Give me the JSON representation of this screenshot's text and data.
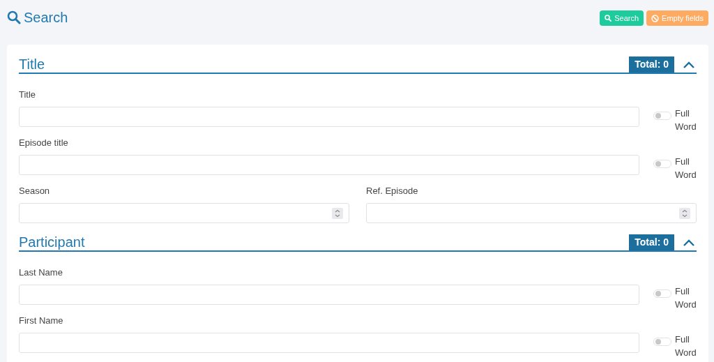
{
  "page": {
    "title": "Search"
  },
  "actions": [
    {
      "kind": "search",
      "label": "Search"
    },
    {
      "kind": "clear",
      "label": "Empty fields"
    }
  ],
  "sections": [
    {
      "title": "Title",
      "total": "Total: 0",
      "expanded": true,
      "rows": [
        {
          "fields": [
            {
              "kind": "text",
              "label": "Title",
              "toggle": {
                "label": "Full Word",
                "on": false
              }
            }
          ]
        },
        {
          "fields": [
            {
              "kind": "text",
              "label": "Episode title",
              "toggle": {
                "label": "Full Word",
                "on": false
              }
            }
          ]
        },
        {
          "fields": [
            {
              "kind": "number",
              "label": "Season"
            },
            {
              "kind": "number",
              "label": "Ref. Episode"
            }
          ]
        }
      ]
    },
    {
      "title": "Participant",
      "total": "Total: 0",
      "expanded": true,
      "rows": [
        {
          "fields": [
            {
              "kind": "text",
              "label": "Last Name",
              "toggle": {
                "label": "Full Word",
                "on": false
              }
            }
          ]
        },
        {
          "fields": [
            {
              "kind": "text",
              "label": "First Name",
              "toggle": {
                "label": "Full Word",
                "on": false
              }
            }
          ]
        }
      ]
    }
  ]
}
